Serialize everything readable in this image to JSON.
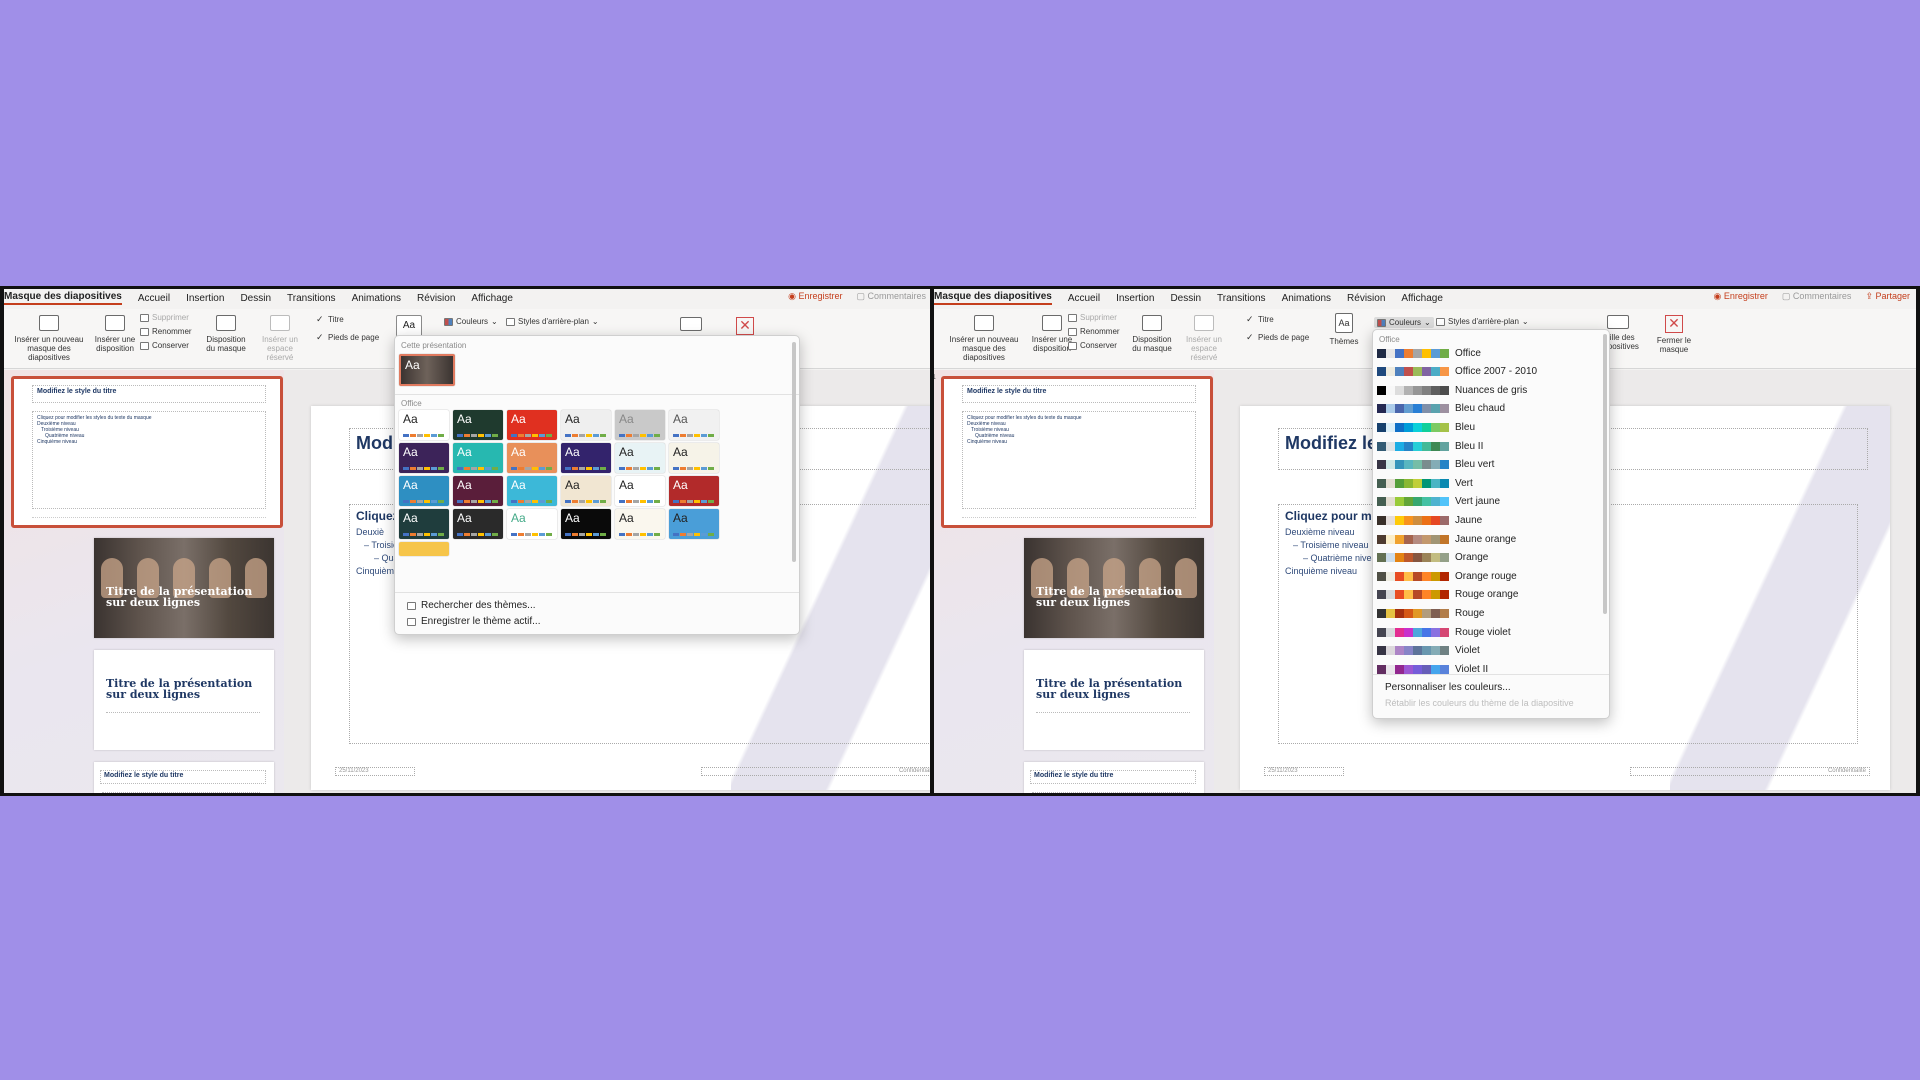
{
  "tabs": [
    "Masque des diapositives",
    "Accueil",
    "Insertion",
    "Dessin",
    "Transitions",
    "Animations",
    "Révision",
    "Affichage"
  ],
  "right_actions": {
    "record": "◉ Enregistrer",
    "comments": "▢ Commentaires",
    "share": "⇪ Partager"
  },
  "ribbon": {
    "insert_master": "Insérer un nouveau\nmasque des diapositives",
    "insert_layout": "Insérer une\ndisposition",
    "delete": "Supprimer",
    "rename": "Renommer",
    "preserve": "Conserver",
    "master_layout": "Disposition\ndu masque",
    "insert_placeholder": "Insérer un\nespace réservé",
    "title_check": "Titre",
    "footer_check": "Pieds de page",
    "themes": "Thèmes",
    "colors": "Couleurs",
    "bg_styles": "Styles d'arrière-plan",
    "slide_size": "Taille des\ndiapositives",
    "close_master": "Fermer le\nmasque",
    "themes_icon_text": "Aa"
  },
  "slides": {
    "master_title": "Modifiez le style du titre",
    "master_body": "Cliquez pour modifier les styles du texte du masque",
    "master_levels": [
      "Deuxième niveau",
      "Troisième niveau",
      "Quatrième niveau",
      "Cinquième niveau"
    ],
    "photo_title": "Titre de la présentation sur deux lignes",
    "white_title": "Titre de la présentation sur deux lignes",
    "small_title": "Modifiez le style du titre",
    "slide_number_left": "1"
  },
  "main_slide": {
    "title_left": "Mod",
    "title_right": "Modifiez le",
    "body_head_left": "Cliquez",
    "body_head_right": "Cliquez pour mo",
    "levels_left": [
      "Deuxiè",
      "– Troisiè",
      "– Quat",
      "Cinquièm"
    ],
    "levels_right": [
      "Deuxième niveau",
      "– Troisième niveau",
      "– Quatrième niveau",
      "Cinquième niveau"
    ],
    "footer_date": "25/11/2023",
    "footer_conf": "Confidentialité"
  },
  "themes_menu": {
    "section_current": "Cette présentation",
    "section_office": "Office",
    "browse": "Rechercher des thèmes...",
    "save": "Enregistrer le thème actif...",
    "tile_text": "Aa"
  },
  "colors_menu": {
    "section": "Office",
    "items": [
      {
        "name": "Office",
        "sw": [
          "#1f2a44",
          "#e7e6e6",
          "#4472c4",
          "#ed7d31",
          "#a5a5a5",
          "#ffc000",
          "#5b9bd5",
          "#70ad47"
        ]
      },
      {
        "name": "Office 2007 - 2010",
        "sw": [
          "#1f497d",
          "#eeece1",
          "#4f81bd",
          "#c0504d",
          "#9bbb59",
          "#8064a2",
          "#4bacc6",
          "#f79646"
        ]
      },
      {
        "name": "Nuances de gris",
        "sw": [
          "#000000",
          "#f8f8f8",
          "#dddddd",
          "#b2b2b2",
          "#969696",
          "#808080",
          "#5f5f5f",
          "#4d4d4d"
        ]
      },
      {
        "name": "Bleu chaud",
        "sw": [
          "#242852",
          "#acccea",
          "#4a66ac",
          "#629dd1",
          "#297fd5",
          "#7f8fa9",
          "#5aa2ae",
          "#9d90a0"
        ]
      },
      {
        "name": "Bleu",
        "sw": [
          "#17406d",
          "#dbeff9",
          "#0f6fc6",
          "#009dd9",
          "#0bd0d9",
          "#10cf9b",
          "#7cca62",
          "#a5c249"
        ]
      },
      {
        "name": "Bleu II",
        "sw": [
          "#335b74",
          "#dfe3e5",
          "#1cade4",
          "#2683c6",
          "#27ced7",
          "#42ba97",
          "#3e8853",
          "#62a39f"
        ]
      },
      {
        "name": "Bleu vert",
        "sw": [
          "#373545",
          "#cee8e6",
          "#3494ba",
          "#58b6c0",
          "#75bda7",
          "#7a8c8e",
          "#84acb6",
          "#2683c6"
        ]
      },
      {
        "name": "Vert",
        "sw": [
          "#455f51",
          "#e3ded1",
          "#549e39",
          "#8ab833",
          "#c0cf3a",
          "#029676",
          "#4ab5c4",
          "#0989b1"
        ]
      },
      {
        "name": "Vert jaune",
        "sw": [
          "#455f51",
          "#e3ded1",
          "#99cb38",
          "#63a537",
          "#37a76f",
          "#44c1a3",
          "#4eb3cf",
          "#51c3f9"
        ]
      },
      {
        "name": "Jaune",
        "sw": [
          "#39302a",
          "#e5dedb",
          "#ffca08",
          "#f8931d",
          "#ce8d3e",
          "#ec7016",
          "#e64823",
          "#9c6a6a"
        ]
      },
      {
        "name": "Jaune orange",
        "sw": [
          "#4e3b30",
          "#fbeec9",
          "#f0a22e",
          "#a5644e",
          "#b58b80",
          "#c3986d",
          "#a19574",
          "#c17529"
        ]
      },
      {
        "name": "Orange",
        "sw": [
          "#637052",
          "#ccddea",
          "#e48312",
          "#bd582c",
          "#865640",
          "#9b8357",
          "#c2bc80",
          "#94a088"
        ]
      },
      {
        "name": "Orange rouge",
        "sw": [
          "#505046",
          "#eeece1",
          "#e84c22",
          "#ffbd47",
          "#b64926",
          "#ff8427",
          "#cc9900",
          "#b22600"
        ]
      },
      {
        "name": "Rouge orange",
        "sw": [
          "#454551",
          "#d8d9dc",
          "#e84c22",
          "#ffbd47",
          "#b64926",
          "#ff8427",
          "#cc9900",
          "#b22600"
        ]
      },
      {
        "name": "Rouge",
        "sw": [
          "#323232",
          "#e5c243",
          "#a5300f",
          "#d55816",
          "#e19825",
          "#b19c7d",
          "#7f5f52",
          "#b27d49"
        ]
      },
      {
        "name": "Rouge violet",
        "sw": [
          "#454551",
          "#d8d9dc",
          "#e32d91",
          "#c830cc",
          "#4ea6dc",
          "#4775e7",
          "#8971e1",
          "#d54773"
        ]
      },
      {
        "name": "Violet",
        "sw": [
          "#373545",
          "#dcd8dc",
          "#ad84c6",
          "#8784c7",
          "#5d739a",
          "#6997af",
          "#84acb6",
          "#6f8183"
        ]
      },
      {
        "name": "Violet II",
        "sw": [
          "#632e62",
          "#eae5eb",
          "#92278f",
          "#9b57d3",
          "#755dd9",
          "#665eb8",
          "#45a5ed",
          "#5982db"
        ]
      }
    ],
    "customize": "Personnaliser les couleurs...",
    "reset": "Rétablir les couleurs du thème de la diapositive"
  },
  "accent_color": "#c43e1c"
}
